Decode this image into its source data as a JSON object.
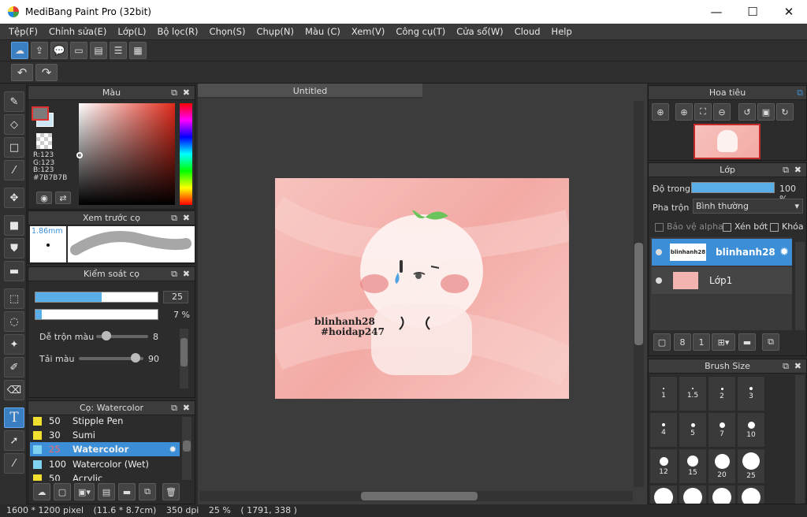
{
  "window": {
    "title": "MediBang Paint Pro (32bit)",
    "minimize": "—",
    "maximize": "☐",
    "close": "✕"
  },
  "menu": [
    "Tệp(F)",
    "Chỉnh sửa(E)",
    "Lớp(L)",
    "Bộ lọc(R)",
    "Chọn(S)",
    "Chụp(N)",
    "Màu (C)",
    "Xem(V)",
    "Công cụ(T)",
    "Cửa sổ(W)",
    "Cloud",
    "Help"
  ],
  "toolbar": {
    "cloud_icon": "cloud-icon",
    "undo_icon": "undo-icon",
    "redo_icon": "redo-icon"
  },
  "canvas": {
    "tab_label": "Untitled",
    "watermark_line1": "blinhanh28",
    "watermark_line2": "#hoidap247"
  },
  "color_panel": {
    "title": "Màu",
    "r": "R:123",
    "g": "G:123",
    "b": "B:123",
    "hex": "#7B7B7B",
    "fg_color": "#7b7b7b",
    "bg_color": "#cfe6f7"
  },
  "brush_preview": {
    "title": "Xem trước cọ",
    "size": "1.86mm"
  },
  "brush_control": {
    "title": "Kiểm soát cọ",
    "size_value": "25",
    "size_fill": 0.54,
    "opacity_value": "7 %",
    "opacity_fill": 0.05,
    "blend_label": "Dễ trộn màu",
    "blend_value": "8",
    "blend_level": 0.1,
    "load_label": "Tải màu",
    "load_value": "90",
    "load_level": 0.88
  },
  "brush_list": {
    "title": "Cọ: Watercolor",
    "items": [
      {
        "size": "50",
        "name": "Stipple Pen",
        "color": "#f2e030"
      },
      {
        "size": "30",
        "name": "Sumi",
        "color": "#f2e030"
      },
      {
        "size": "25",
        "name": "Watercolor",
        "color": "#7fd3f0",
        "selected": true
      },
      {
        "size": "100",
        "name": "Watercolor (Wet)",
        "color": "#7fd3f0"
      },
      {
        "size": "50",
        "name": "Acrylic",
        "color": "#f2e030"
      }
    ]
  },
  "navigator": {
    "title": "Hoa tiêu"
  },
  "layers": {
    "title": "Lớp",
    "opacity_label": "Độ trong",
    "opacity_value": "100 %",
    "opacity_level": 1.0,
    "blend_label": "Pha trộn",
    "blend_value": "Bình thường",
    "protect_alpha": "Bảo vệ alpha",
    "clipping": "Xén bớt",
    "lock": "Khóa",
    "items": [
      {
        "name": "blinhanh28",
        "thumb_text": "blinhanh28",
        "selected": true
      },
      {
        "name": "Lớp1",
        "selected": false
      }
    ]
  },
  "brush_size": {
    "title": "Brush Size",
    "sizes": [
      "1",
      "1.5",
      "2",
      "3",
      "4",
      "5",
      "7",
      "10",
      "12",
      "15",
      "20",
      "25"
    ]
  },
  "status": {
    "dimensions": "1600 * 1200 pixel",
    "physical": "(11.6 * 8.7cm)",
    "dpi": "350 dpi",
    "zoom": "25 %",
    "coords": "( 1791, 338 )"
  }
}
